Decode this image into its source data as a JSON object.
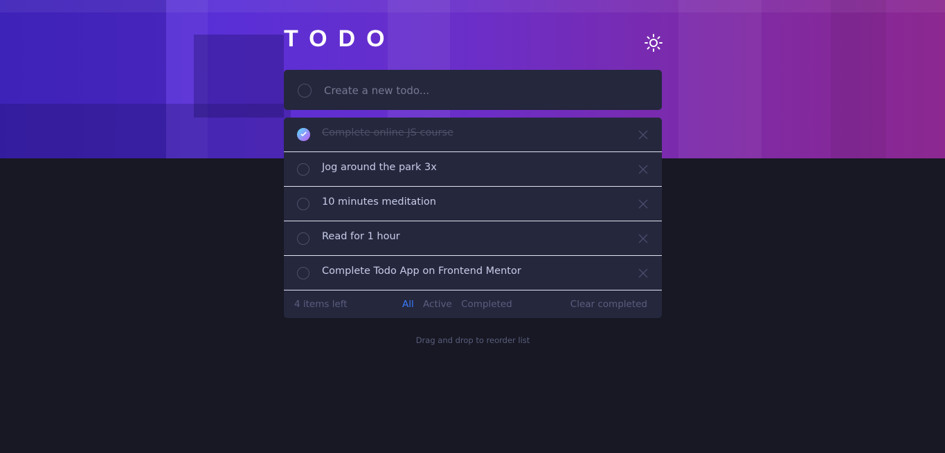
{
  "app": {
    "title": "TODO"
  },
  "new_todo": {
    "placeholder": "Create a new todo..."
  },
  "todos": [
    {
      "text": "Complete online JS course",
      "completed": true
    },
    {
      "text": "Jog around the park 3x",
      "completed": false
    },
    {
      "text": "10 minutes meditation",
      "completed": false
    },
    {
      "text": "Read for 1 hour",
      "completed": false
    },
    {
      "text": "Complete Todo App on Frontend Mentor",
      "completed": false
    }
  ],
  "footer": {
    "items_left": "4 items left",
    "filters": [
      {
        "label": "All",
        "active": true
      },
      {
        "label": "Active",
        "active": false
      },
      {
        "label": "Completed",
        "active": false
      }
    ],
    "clear_label": "Clear completed"
  },
  "hint": "Drag and drop to reorder list",
  "icons": {
    "theme_toggle": "sun-icon",
    "check": "check-icon",
    "delete": "cross-icon"
  },
  "colors": {
    "background": "#171823",
    "card": "#25273d",
    "text": "#c8cbe7",
    "muted": "#5b5e7e",
    "accent": "#3a7cfd",
    "check_gradient_start": "#55ddff",
    "check_gradient_end": "#c058f3"
  }
}
